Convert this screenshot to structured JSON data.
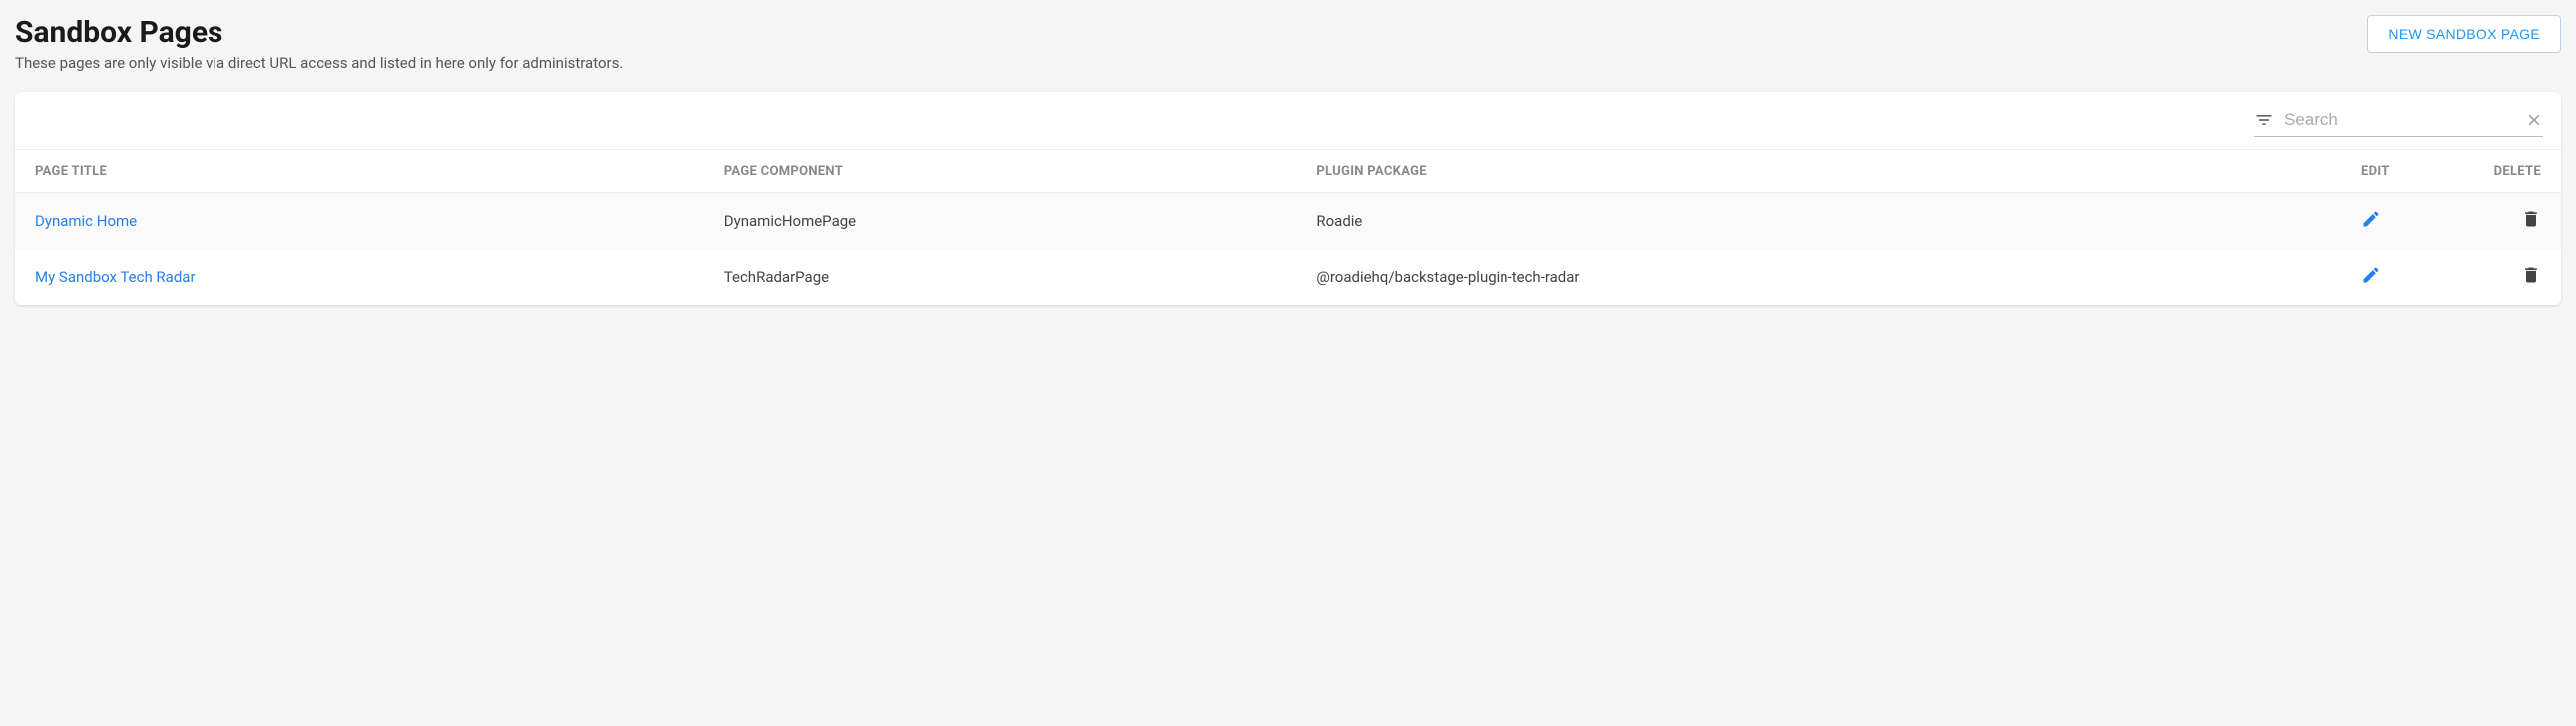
{
  "header": {
    "title": "Sandbox Pages",
    "subtitle": "These pages are only visible via direct URL access and listed in here only for administrators.",
    "new_button": "NEW SANDBOX PAGE"
  },
  "search": {
    "placeholder": "Search",
    "value": ""
  },
  "table": {
    "columns": {
      "page_title": "PAGE TITLE",
      "page_component": "PAGE COMPONENT",
      "plugin_package": "PLUGIN PACKAGE",
      "edit": "EDIT",
      "delete": "DELETE"
    },
    "rows": [
      {
        "page_title": "Dynamic Home",
        "page_component": "DynamicHomePage",
        "plugin_package": "Roadie"
      },
      {
        "page_title": "My Sandbox Tech Radar",
        "page_component": "TechRadarPage",
        "plugin_package": "@roadiehq/backstage-plugin-tech-radar"
      }
    ]
  }
}
